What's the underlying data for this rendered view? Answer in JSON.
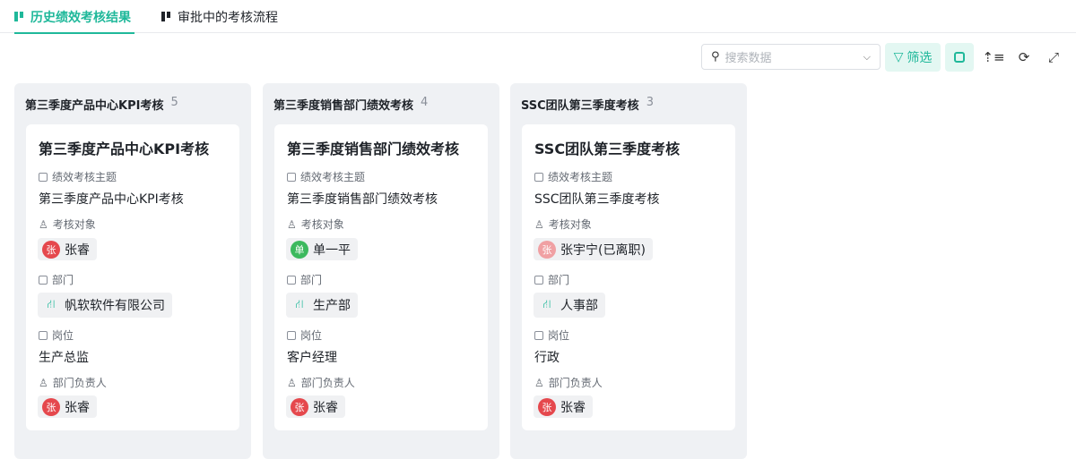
{
  "tabs": [
    {
      "label": "历史绩效考核结果",
      "active": true
    },
    {
      "label": "审批中的考核流程",
      "active": false
    }
  ],
  "toolbar": {
    "search_placeholder": "搜索数据",
    "filter_label": "筛选",
    "icons": [
      "search-icon",
      "chevron-down-icon",
      "filter-icon",
      "card-view-icon",
      "sort-icon",
      "refresh-icon",
      "fullscreen-icon"
    ]
  },
  "colors": {
    "accent": "#1fb89a",
    "avatar_red": "#e5484d",
    "avatar_green": "#3cb95e",
    "avatar_inactive": "#f0a0a3"
  },
  "fields": {
    "topic": "绩效考核主题",
    "target": "考核对象",
    "dept": "部门",
    "position": "岗位",
    "manager": "部门负责人"
  },
  "columns": [
    {
      "title": "第三季度产品中心KPI考核",
      "count": "5",
      "card": {
        "title": "第三季度产品中心KPI考核",
        "topic": "第三季度产品中心KPI考核",
        "target": {
          "avatar": "张",
          "name": "张睿"
        },
        "dept": "帆软软件有限公司",
        "position": "生产总监",
        "manager": {
          "avatar": "张",
          "name": "张睿"
        }
      }
    },
    {
      "title": "第三季度销售部门绩效考核",
      "count": "4",
      "card": {
        "title": "第三季度销售部门绩效考核",
        "topic": "第三季度销售部门绩效考核",
        "target": {
          "avatar": "单",
          "name": "单一平"
        },
        "dept": "生产部",
        "position": "客户经理",
        "manager": {
          "avatar": "张",
          "name": "张睿"
        }
      }
    },
    {
      "title": "SSC团队第三季度考核",
      "count": "3",
      "card": {
        "title": "SSC团队第三季度考核",
        "topic": "SSC团队第三季度考核",
        "target": {
          "avatar": "张",
          "name": "张宇宁(已离职)"
        },
        "dept": "人事部",
        "position": "行政",
        "manager": {
          "avatar": "张",
          "name": "张睿"
        }
      }
    }
  ]
}
